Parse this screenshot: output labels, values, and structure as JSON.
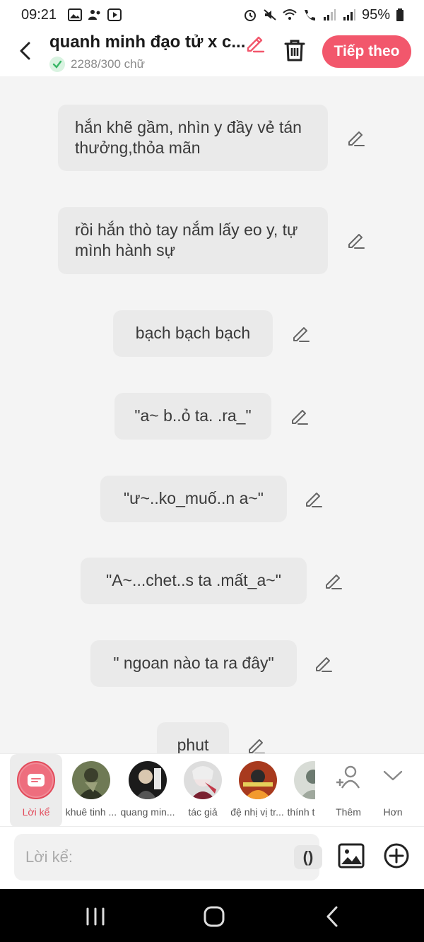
{
  "status_bar": {
    "time": "09:21",
    "battery": "95%"
  },
  "header": {
    "title": "quanh minh đạo tử x c...",
    "word_count": "2288/300 chữ",
    "next_label": "Tiếp theo",
    "accent": "#f2576c"
  },
  "messages": [
    {
      "text": "hắn khẽ gầm, nhìn y đầy vẻ tán thưởng,thỏa mãn"
    },
    {
      "text": "rồi hắn thò tay nắm lấy eo y, tự mình hành sự"
    },
    {
      "text": "bạch bạch bạch"
    },
    {
      "text": "\"a~ b..ỏ ta. .ra_\""
    },
    {
      "text": "\"ư~..ko_muố..n a~\""
    },
    {
      "text": "\"A~...chet..s ta .mất_a~\""
    },
    {
      "text": "\" ngoan nào ta ra đây\""
    },
    {
      "text": "phut"
    }
  ],
  "characters": [
    {
      "label": "Lời kể"
    },
    {
      "label": "khuê tinh ..."
    },
    {
      "label": "quang min..."
    },
    {
      "label": "tác giả"
    },
    {
      "label": "đệ nhị vị tr..."
    },
    {
      "label": "thính t"
    },
    {
      "label": "Thêm"
    },
    {
      "label": "Hơn"
    }
  ],
  "input": {
    "placeholder": "Lời kể:",
    "paren_label": "()"
  }
}
